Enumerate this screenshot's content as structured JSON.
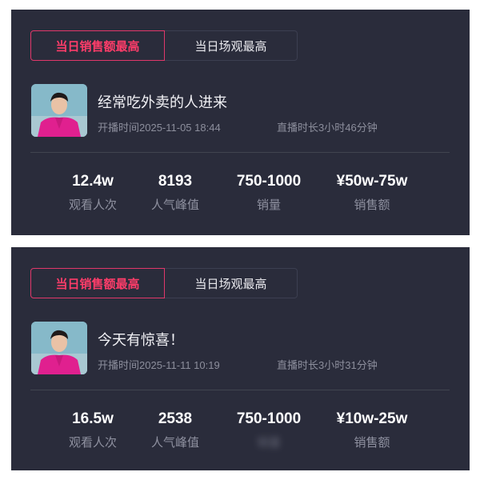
{
  "cards": [
    {
      "tabs": {
        "active": "当日销售额最高",
        "inactive": "当日场观最高"
      },
      "title": "经常吃外卖的人进来",
      "start_time": "开播时间2025-11-05 18:44",
      "duration": "直播时长3小时46分钟",
      "stats": [
        {
          "value": "12.4w",
          "label": "观看人次"
        },
        {
          "value": "8193",
          "label": "人气峰值"
        },
        {
          "value": "750-1000",
          "label": "销量"
        },
        {
          "value": "¥50w-75w",
          "label": "销售额"
        }
      ]
    },
    {
      "tabs": {
        "active": "当日销售额最高",
        "inactive": "当日场观最高"
      },
      "title": "今天有惊喜！",
      "start_time": "开播时间2025-11-11 10:19",
      "duration": "直播时长3小时31分钟",
      "stats": [
        {
          "value": "16.5w",
          "label": "观看人次"
        },
        {
          "value": "2538",
          "label": "人气峰值"
        },
        {
          "value": "750-1000",
          "label": "销量"
        },
        {
          "value": "¥10w-25w",
          "label": "销售额"
        }
      ]
    }
  ],
  "colors": {
    "card_bg": "#2a2c3b",
    "accent": "#ff3d6a",
    "muted_text": "#8c8e9c"
  }
}
